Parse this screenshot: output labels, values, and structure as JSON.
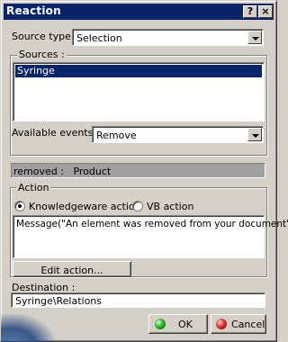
{
  "window": {
    "title": "Reaction",
    "help_glyph": "?",
    "close_glyph": "×"
  },
  "source_type": {
    "label": "Source type :",
    "value": "Selection"
  },
  "sources": {
    "label": "Sources :",
    "items": [
      "Syringe"
    ],
    "selected_index": 0
  },
  "available_events": {
    "label": "Available events :",
    "value": "Remove"
  },
  "status": {
    "text": "removed :   Product"
  },
  "action": {
    "label": "Action",
    "radio_knowledgeware": "Knowledgeware action",
    "radio_vb": "VB action",
    "selected": "knowledgeware",
    "script": "Message(\"An element was removed from your document\")",
    "edit_button": "Edit action..."
  },
  "destination": {
    "label": "Destination :",
    "value": "Syringe\\Relations"
  },
  "buttons": {
    "ok": "OK",
    "cancel": "Cancel"
  },
  "colors": {
    "title_bar": "#0a246a",
    "dialog_bg": "#d4d0c8",
    "selection": "#0a246a",
    "status_bg": "#a0a0a0"
  },
  "icons": {
    "ok": "green-ball-icon",
    "cancel": "red-ball-icon"
  }
}
